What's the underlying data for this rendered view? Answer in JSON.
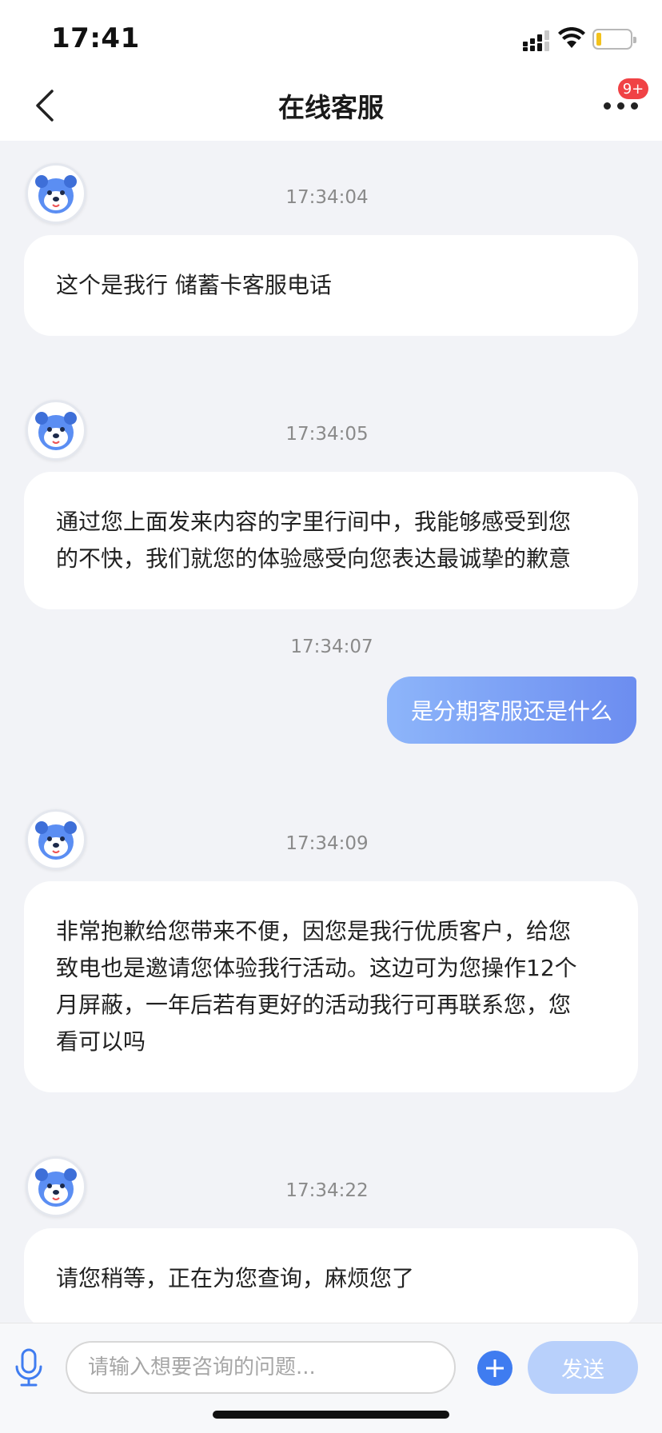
{
  "status_bar": {
    "time": "17:41"
  },
  "nav": {
    "title": "在线客服",
    "badge": "9+"
  },
  "messages": [
    {
      "sender": "bot",
      "time": "17:34:04",
      "text": "这个是我行 储蓄卡客服电话"
    },
    {
      "sender": "bot",
      "time": "17:34:05",
      "lines": [
        "通过您上面发来内容的字里行间中，我能够感受到您",
        "的不快，我们就您的体验感受向您表达最诚挚的歉意"
      ]
    },
    {
      "sender": "user",
      "time": "17:34:07",
      "text": "是分期客服还是什么"
    },
    {
      "sender": "bot",
      "time": "17:34:09",
      "lines": [
        "非常抱歉给您带来不便，因您是我行优质客户，给您",
        "致电也是邀请您体验我行活动。这边可为您操作12个",
        "月屏蔽，一年后若有更好的活动我行可再联系您，您",
        "看可以吗"
      ]
    },
    {
      "sender": "bot",
      "time": "17:34:22",
      "text": "请您稍等，正在为您查询，麻烦您了"
    }
  ],
  "input": {
    "placeholder": "请输入想要咨询的问题...",
    "value": ""
  },
  "send_label": "发送",
  "icons": {
    "back": "chevron-left-icon",
    "more": "more-dots-icon",
    "mic": "microphone-icon",
    "plus": "plus-icon",
    "avatar": "bear-agent-avatar"
  },
  "colors": {
    "accent": "#3f7cf0",
    "user_bubble_start": "#8db5fa",
    "user_bubble_end": "#6c8df0",
    "badge": "#f04245",
    "send_disabled": "#b8d0fb",
    "battery_level": "#f3c21c"
  }
}
